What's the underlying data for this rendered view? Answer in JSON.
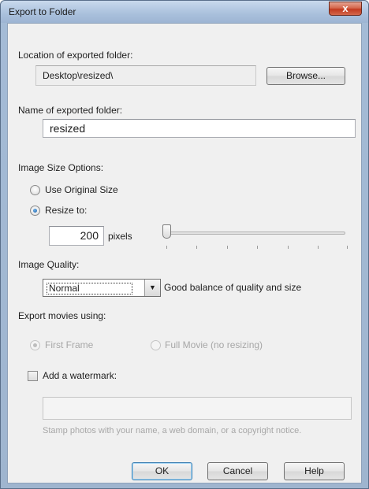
{
  "window": {
    "title": "Export to Folder",
    "close_label": "x"
  },
  "location": {
    "label": "Location of exported folder:",
    "path": "Desktop\\resized\\",
    "browse_label": "Browse..."
  },
  "folder_name": {
    "label": "Name of exported folder:",
    "value": "resized"
  },
  "size_options": {
    "label": "Image Size Options:",
    "use_original_label": "Use Original Size",
    "resize_label": "Resize to:",
    "selected": "resize",
    "pixels_value": "200",
    "pixels_unit": "pixels",
    "slider_level": 0.0
  },
  "quality": {
    "label": "Image Quality:",
    "selected": "Normal",
    "description": "Good balance of quality and size"
  },
  "movies": {
    "label": "Export movies using:",
    "first_frame_label": "First Frame",
    "full_movie_label": "Full Movie (no resizing)",
    "selected": "first_frame"
  },
  "watermark": {
    "label": "Add a watermark:",
    "checked": false,
    "value": "",
    "hint": "Stamp photos with your name, a web domain, or a copyright notice."
  },
  "buttons": {
    "ok_label": "OK",
    "cancel_label": "Cancel",
    "help_label": "Help"
  },
  "icons": {
    "close": "close-icon",
    "dropdown": "chevron-down-icon"
  }
}
